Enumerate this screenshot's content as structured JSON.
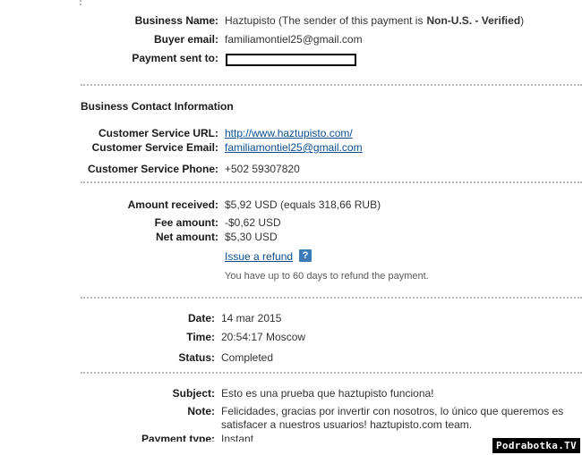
{
  "business": {
    "name_label": "Business Name:",
    "name_value": "Haztupisto",
    "name_note_pre": "(The sender of this payment is",
    "name_note_bold": "Non-U.S. - Verified",
    "name_note_post": ")",
    "buyer_email_label": "Buyer email:",
    "buyer_email_value": "familiamontiel25@gmail.com",
    "payment_sent_label": "Payment sent to:"
  },
  "contact": {
    "heading": "Business Contact Information",
    "url_label": "Customer Service URL:",
    "url_value": "http://www.haztupisto.com/",
    "email_label": "Customer Service Email:",
    "email_value": "familiamontiel25@gmail.com",
    "phone_label": "Customer Service Phone:",
    "phone_value": "+502 59307820"
  },
  "amounts": {
    "received_label": "Amount received:",
    "received_value": "$5,92 USD (equals 318,66 RUB)",
    "fee_label": "Fee amount:",
    "fee_value": "-$0,62 USD",
    "net_label": "Net amount:",
    "net_value": "$5,30 USD",
    "refund_link": "Issue a refund",
    "help_icon_glyph": "?",
    "refund_note": "You have up to 60 days to refund the payment."
  },
  "details": {
    "date_label": "Date:",
    "date_value": "14 mar 2015",
    "time_label": "Time:",
    "time_value": "20:54:17 Moscow",
    "status_label": "Status:",
    "status_value": "Completed"
  },
  "message": {
    "subject_label": "Subject:",
    "subject_value": "Esto es una prueba que haztupisto funciona!",
    "note_label": "Note:",
    "note_line1": "Felicidades, gracias por invertir con nosotros, lo único que queremos es",
    "note_line2": "satisfacer a nuestros usuarios! haztupisto.com team.",
    "payment_type_label": "Payment type:",
    "payment_type_value": "Instant"
  },
  "watermark": "Podrabotka.TV"
}
